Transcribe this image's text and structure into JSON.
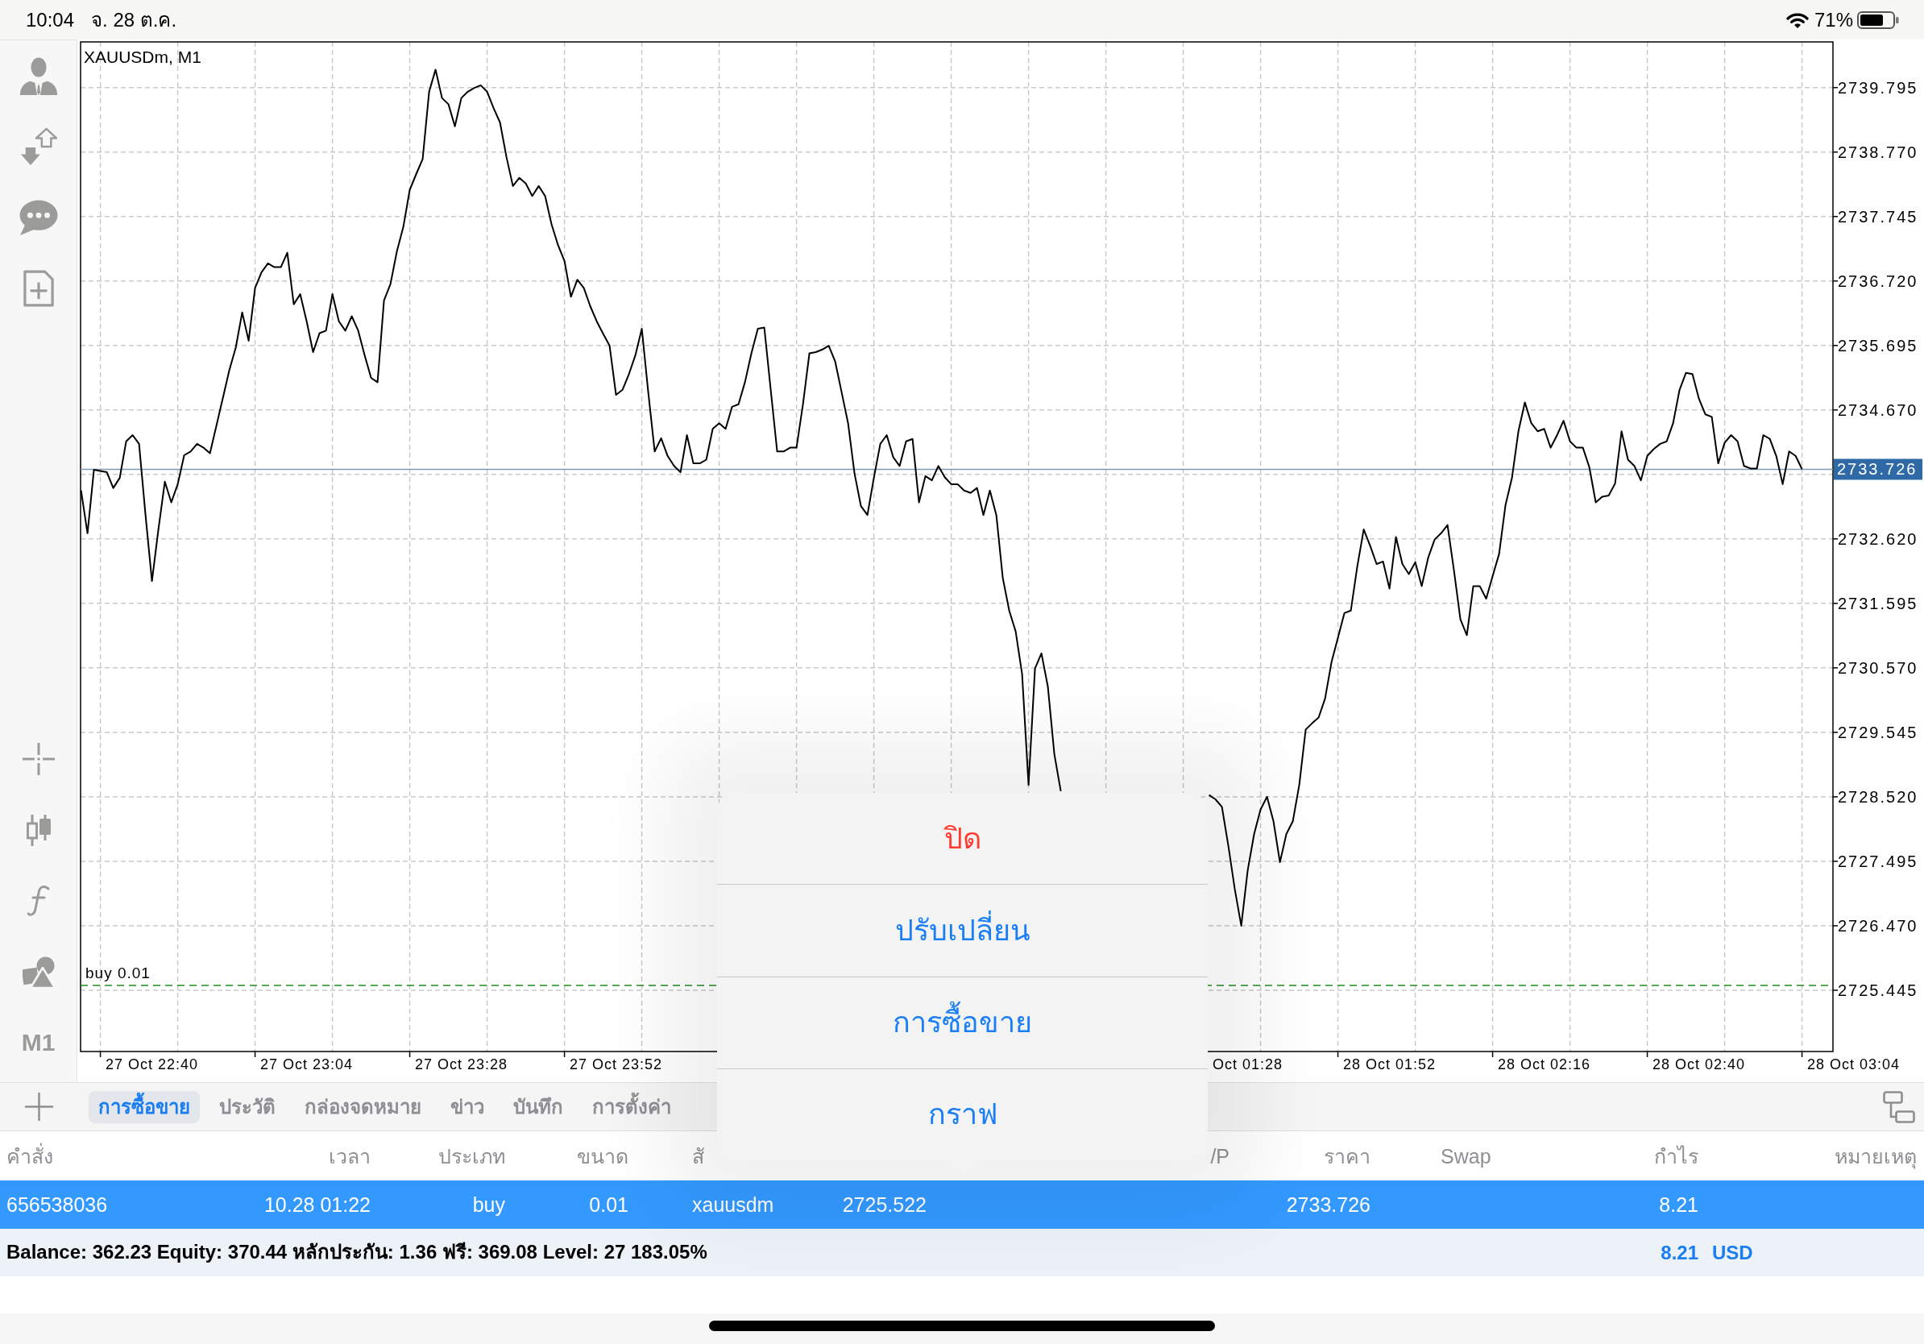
{
  "status_bar": {
    "time": "10:04",
    "date": "จ. 28 ต.ค.",
    "battery": "71%"
  },
  "toolbar": {
    "timeframe": "M1"
  },
  "chart": {
    "chart_data": {
      "type": "line",
      "title": "XAUUSDm, M1",
      "grid": true,
      "categories": [
        null,
        null,
        null,
        null,
        null,
        null,
        null,
        null,
        null,
        null,
        null,
        "27 Oct 22:40",
        null,
        null,
        null,
        null,
        null,
        null,
        null,
        null,
        null,
        null,
        null,
        null,
        null,
        null,
        null,
        null,
        null,
        null,
        null,
        null,
        null,
        null,
        null,
        "27 Oct 23:04",
        null,
        null,
        null,
        null,
        null,
        null,
        null,
        null,
        null,
        null,
        null,
        null,
        null,
        null,
        null,
        null,
        null,
        null,
        null,
        null,
        null,
        null,
        null,
        "27 Oct 23:28",
        null,
        null,
        null,
        null,
        null,
        null,
        null,
        null,
        null,
        null,
        null,
        null,
        null,
        null,
        null,
        null,
        null,
        null,
        null,
        null,
        null,
        null,
        null,
        "27 Oct 23:52",
        null,
        null,
        null,
        null,
        null,
        null,
        null,
        null,
        null,
        null,
        null,
        null,
        null,
        null,
        null,
        null,
        null,
        null,
        null,
        null,
        null,
        null,
        null,
        null,
        null,
        null,
        null,
        null,
        null,
        null,
        null,
        null,
        null,
        null,
        null,
        null,
        null,
        null,
        null,
        null,
        null,
        null,
        null,
        null,
        null,
        null,
        null,
        null,
        null,
        null,
        null,
        null,
        null,
        null,
        null,
        null,
        null,
        null,
        null,
        null,
        null,
        null,
        null,
        null,
        null,
        null,
        null,
        null,
        null,
        null,
        null,
        null,
        null,
        null,
        null,
        null,
        null,
        null,
        null,
        null,
        null,
        null,
        null,
        null,
        null,
        null,
        null,
        null,
        null,
        null,
        null,
        null,
        null,
        null,
        null,
        null,
        null,
        "Oct 01:28",
        null,
        null,
        null,
        null,
        null,
        null,
        null,
        null,
        null,
        null,
        null,
        null,
        null,
        null,
        null,
        null,
        null,
        null,
        null,
        null,
        null,
        "28 Oct 01:52",
        null,
        null,
        null,
        null,
        null,
        null,
        null,
        null,
        null,
        null,
        null,
        null,
        null,
        null,
        null,
        null,
        null,
        null,
        null,
        null,
        null,
        null,
        null,
        "28 Oct 02:16",
        null,
        null,
        null,
        null,
        null,
        null,
        null,
        null,
        null,
        null,
        null,
        null,
        null,
        null,
        null,
        null,
        null,
        null,
        null,
        null,
        null,
        null,
        null,
        "28 Oct 02:40",
        null,
        null,
        null,
        null,
        null,
        null,
        null,
        null,
        null,
        null,
        null,
        null,
        null,
        null,
        null,
        null,
        null,
        null,
        null,
        null,
        null,
        null,
        null,
        "28 Oct 03:04"
      ],
      "series": [
        {
          "color": "#000000",
          "values": [
            2733.39,
            2732.71,
            2733.72,
            2733.7,
            2733.68,
            2733.43,
            2733.59,
            2734.17,
            2734.27,
            2734.13,
            2733.0,
            2731.95,
            2732.77,
            2733.53,
            2733.2,
            2733.49,
            2733.95,
            2734.01,
            2734.13,
            2734.07,
            2733.98,
            2734.42,
            2734.86,
            2735.3,
            2735.66,
            2736.22,
            2735.77,
            2736.61,
            2736.86,
            2737.0,
            2736.94,
            2736.94,
            2737.17,
            2736.35,
            2736.51,
            2736.08,
            2735.59,
            2735.89,
            2735.93,
            2736.51,
            2736.08,
            2735.93,
            2736.16,
            2735.93,
            2735.54,
            2735.18,
            2735.11,
            2736.41,
            2736.67,
            2737.19,
            2737.58,
            2738.17,
            2738.42,
            2738.66,
            2739.73,
            2740.08,
            2739.63,
            2739.53,
            2739.18,
            2739.63,
            2739.73,
            2739.79,
            2739.83,
            2739.73,
            2739.47,
            2739.24,
            2738.69,
            2738.23,
            2738.36,
            2738.27,
            2738.07,
            2738.23,
            2738.07,
            2737.62,
            2737.29,
            2737.04,
            2736.47,
            2736.74,
            2736.61,
            2736.32,
            2736.08,
            2735.88,
            2735.69,
            2734.91,
            2734.99,
            2735.24,
            2735.54,
            2735.96,
            2734.95,
            2734.01,
            2734.22,
            2733.94,
            2733.78,
            2733.68,
            2734.27,
            2733.82,
            2733.82,
            2733.88,
            2734.37,
            2734.46,
            2734.37,
            2734.72,
            2734.76,
            2735.11,
            2735.57,
            2735.96,
            2735.98,
            2734.99,
            2734.01,
            2734.01,
            2734.07,
            2734.07,
            2734.76,
            2735.57,
            2735.59,
            2735.63,
            2735.69,
            2735.44,
            2734.95,
            2734.46,
            2733.66,
            2733.14,
            2733.0,
            2733.59,
            2734.13,
            2734.27,
            2733.92,
            2733.78,
            2734.17,
            2734.21,
            2733.2,
            2733.62,
            2733.55,
            2733.78,
            2733.6,
            2733.49,
            2733.49,
            2733.39,
            2733.35,
            2733.43,
            2733.0,
            2733.39,
            2733.0,
            2732.0,
            2731.48,
            2731.15,
            2730.47,
            2728.71,
            2730.56,
            2730.8,
            2730.27,
            2729.2,
            2728.61,
            null,
            null,
            null,
            null,
            null,
            null,
            null,
            null,
            null,
            null,
            null,
            null,
            null,
            null,
            null,
            null,
            null,
            null,
            null,
            null,
            null,
            null,
            2728.55,
            2728.48,
            2728.36,
            2727.74,
            2727.05,
            2726.47,
            2727.35,
            2727.93,
            2728.32,
            2728.52,
            2728.13,
            2727.48,
            2727.93,
            2728.13,
            2728.71,
            2729.59,
            2729.69,
            2729.78,
            2730.08,
            2730.66,
            2731.05,
            2731.44,
            2731.48,
            2732.18,
            2732.77,
            2732.51,
            2732.22,
            2732.26,
            2731.83,
            2732.65,
            2732.22,
            2732.06,
            2732.25,
            2731.87,
            2732.32,
            2732.61,
            2732.71,
            2732.84,
            2732.12,
            2731.34,
            2731.09,
            2731.87,
            2731.87,
            2731.67,
            2732.03,
            2732.38,
            2733.16,
            2733.59,
            2734.33,
            2734.79,
            2734.46,
            2734.33,
            2734.37,
            2734.07,
            2734.27,
            2734.5,
            2734.17,
            2734.07,
            2734.07,
            2733.76,
            2733.2,
            2733.29,
            2733.31,
            2733.5,
            2734.33,
            2733.88,
            2733.78,
            2733.55,
            2733.94,
            2734.05,
            2734.13,
            2734.17,
            2734.46,
            2734.99,
            2735.26,
            2735.24,
            2734.85,
            2734.6,
            2734.56,
            2733.82,
            2734.15,
            2734.27,
            2734.17,
            2733.78,
            2733.74,
            2733.74,
            2734.27,
            2734.21,
            2733.94,
            2733.49,
            2734.01,
            2733.94,
            2733.73,
            null,
            null,
            null,
            null,
            null,
            null,
            null,
            null
          ]
        }
      ],
      "ylim": [
        2724.471,
        2740.521
      ],
      "yticks": [
        {
          "value": 2739.795,
          "label": "2739.795"
        },
        {
          "value": 2738.77,
          "label": "2738.770"
        },
        {
          "value": 2737.745,
          "label": "2737.745"
        },
        {
          "value": 2736.72,
          "label": "2736.720"
        },
        {
          "value": 2735.695,
          "label": "2735.695"
        },
        {
          "value": 2734.67,
          "label": "2734.670"
        },
        {
          "value": 2732.62,
          "label": "2732.620"
        },
        {
          "value": 2731.595,
          "label": "2731.595"
        },
        {
          "value": 2730.57,
          "label": "2730.570"
        },
        {
          "value": 2729.545,
          "label": "2729.545"
        },
        {
          "value": 2728.52,
          "label": "2728.520"
        },
        {
          "value": 2727.495,
          "label": "2727.495"
        },
        {
          "value": 2726.47,
          "label": "2726.470"
        },
        {
          "value": 2725.445,
          "label": "2725.445"
        }
      ],
      "ref_lines": [
        {
          "axis": "y",
          "value": 2733.726,
          "label": "2733.726",
          "color": "#7f99b5"
        },
        {
          "axis": "y",
          "value": 2725.522,
          "label": "buy 0.01",
          "color": "#1f8a1f"
        }
      ]
    }
  },
  "popup_menu": {
    "items": [
      {
        "label": "ปิด",
        "kind": "destructive"
      },
      {
        "label": "ปรับเปลี่ยน",
        "kind": "default"
      },
      {
        "label": "การซื้อขาย",
        "kind": "default"
      },
      {
        "label": "กราฟ",
        "kind": "default"
      }
    ]
  },
  "terminal": {
    "tabs": [
      {
        "label": "การซื้อขาย",
        "selected": true
      },
      {
        "label": "ประวัติ",
        "selected": false
      },
      {
        "label": "กล่องจดหมาย",
        "selected": false
      },
      {
        "label": "ข่าว",
        "selected": false
      },
      {
        "label": "บันทึก",
        "selected": false
      },
      {
        "label": "การตั้งค่า",
        "selected": false
      }
    ],
    "columns": [
      "คำสั่ง",
      "เวลา",
      "ประเภท",
      "ขนาด",
      "สั",
      "/P",
      "ราคา",
      "Swap",
      "กำไร",
      "หมายเหตุ"
    ],
    "rows": [
      {
        "selected": true,
        "order": "656538036",
        "time": "10.28 01:22",
        "type": "buy",
        "volume": "0.01",
        "symbol": "xauusdm",
        "open_price": "2725.522",
        "price": "2733.726",
        "profit": "8.21"
      }
    ],
    "summary": {
      "text": "Balance: 362.23 Equity: 370.44 หลักประกัน: 1.36 ฟรี: 369.08 Level: 27 183.05%",
      "profit": "8.21",
      "currency": "USD"
    }
  }
}
